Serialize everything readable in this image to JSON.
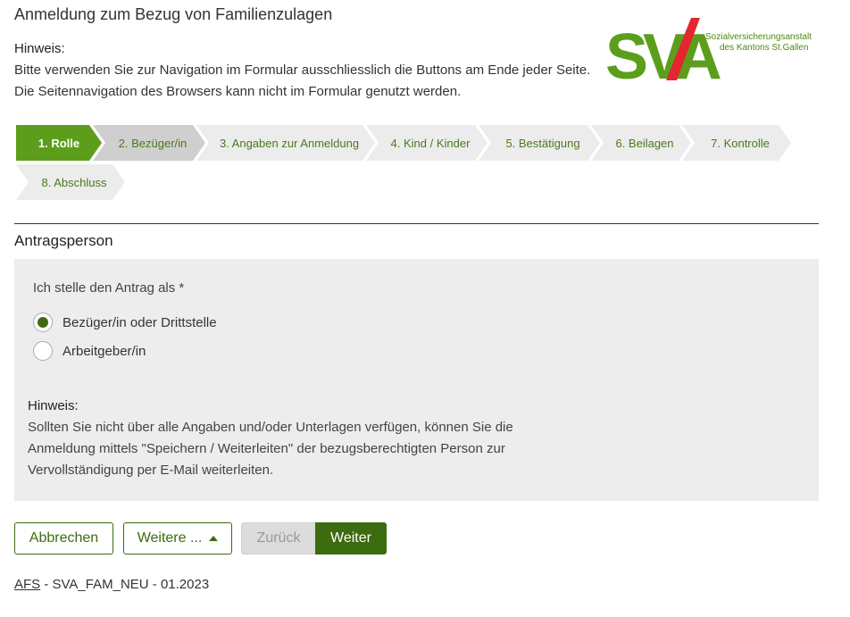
{
  "header": {
    "title": "Anmeldung zum Bezug von Familienzulagen",
    "notice_label": "Hinweis:",
    "notice_line1": "Bitte verwenden Sie zur Navigation im Formular ausschliesslich die Buttons am Ende jeder Seite.",
    "notice_line2": "Die Seitennavigation des Browsers kann nicht im Formular genutzt werden."
  },
  "logo": {
    "wordmark": "SVA",
    "sub_line1": "Sozialversicherungsanstalt",
    "sub_line2": "des Kantons St.Gallen",
    "colors": {
      "green": "#5c9e1c",
      "red": "#e3262f"
    }
  },
  "steps": [
    {
      "label": "1. Rolle",
      "state": "active"
    },
    {
      "label": "2. Bezüger/in",
      "state": "visited"
    },
    {
      "label": "3. Angaben zur Anmeldung",
      "state": "pending"
    },
    {
      "label": "4. Kind / Kinder",
      "state": "pending"
    },
    {
      "label": "5. Bestätigung",
      "state": "pending"
    },
    {
      "label": "6. Beilagen",
      "state": "pending"
    },
    {
      "label": "7. Kontrolle",
      "state": "pending"
    },
    {
      "label": "8. Abschluss",
      "state": "pending"
    }
  ],
  "section": {
    "title": "Antragsperson",
    "question": "Ich stelle den Antrag als  *",
    "options": [
      {
        "label": "Bezüger/in oder Drittstelle",
        "selected": true
      },
      {
        "label": "Arbeitgeber/in",
        "selected": false
      }
    ],
    "hint_label": "Hinweis:",
    "hint_line1": "Sollten Sie nicht über alle Angaben und/oder Unterlagen verfügen, können Sie die",
    "hint_line2": "Anmeldung mittels \"Speichern / Weiterleiten\" der bezugsberechtigten Person zur",
    "hint_line3": "Vervollständigung per E-Mail weiterleiten."
  },
  "buttons": {
    "cancel": "Abbrechen",
    "more": "Weitere ...",
    "back": "Zurück",
    "next": "Weiter"
  },
  "footer": {
    "link": "AFS",
    "text": " - SVA_FAM_NEU - 01.2023"
  },
  "colors": {
    "accent": "#5c9e1c",
    "dark_green": "#3d6b10",
    "panel_bg": "#ededed"
  }
}
